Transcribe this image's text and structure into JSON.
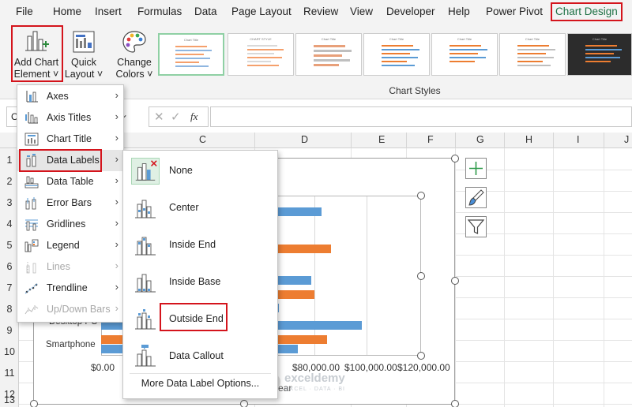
{
  "menubar": {
    "tabs": [
      "File",
      "Home",
      "Insert",
      "Formulas",
      "Data",
      "Page Layout",
      "Review",
      "View",
      "Developer",
      "Help",
      "Power Pivot",
      "Chart Design"
    ],
    "active_tab": "Chart Design"
  },
  "ribbon": {
    "add_chart_element": {
      "line1": "Add Chart",
      "line2": "Element ˅"
    },
    "quick_layout": {
      "line1": "Quick",
      "line2": "Layout ˅"
    },
    "change_colors": {
      "line1": "Change",
      "line2": "Colors ˅"
    },
    "chart_styles_label": "Chart Styles"
  },
  "formula_bar": {
    "fx": "fx",
    "name_box_char": "C"
  },
  "columns": [
    "C",
    "D",
    "E",
    "F",
    "G",
    "H",
    "I",
    "J"
  ],
  "rows": [
    "1",
    "2",
    "3",
    "4",
    "5",
    "6",
    "7",
    "8",
    "9",
    "10",
    "11",
    "12",
    "13"
  ],
  "menu_add_chart_element": {
    "items": [
      {
        "label": "Axes",
        "enabled": true
      },
      {
        "label": "Axis Titles",
        "enabled": true
      },
      {
        "label": "Chart Title",
        "enabled": true
      },
      {
        "label": "Data Labels",
        "enabled": true,
        "highlighted": true
      },
      {
        "label": "Data Table",
        "enabled": true
      },
      {
        "label": "Error Bars",
        "enabled": true
      },
      {
        "label": "Gridlines",
        "enabled": true
      },
      {
        "label": "Legend",
        "enabled": true
      },
      {
        "label": "Lines",
        "enabled": false
      },
      {
        "label": "Trendline",
        "enabled": true
      },
      {
        "label": "Up/Down Bars",
        "enabled": false
      }
    ]
  },
  "menu_data_labels": {
    "items": [
      "None",
      "Center",
      "Inside End",
      "Inside Base",
      "Outside End",
      "Data Callout"
    ],
    "selected": "None",
    "boxed": "Outside End",
    "more_options": "More Data Label Options..."
  },
  "chart": {
    "x_ticks": [
      "$0.00",
      "$80,000.00",
      "$100,000.00",
      "$120,000.00"
    ],
    "categories_visible": [
      "Desktop PC",
      "Smartphone"
    ],
    "xlabel_fragment": "ear"
  },
  "watermark": {
    "brand": "exceldemy",
    "tagline": "EXCEL · DATA · BI"
  },
  "colors": {
    "excel_green": "#1e7145",
    "highlight_red": "#d4141c",
    "series_blue": "#5b9bd5",
    "series_orange": "#ed7d31"
  }
}
